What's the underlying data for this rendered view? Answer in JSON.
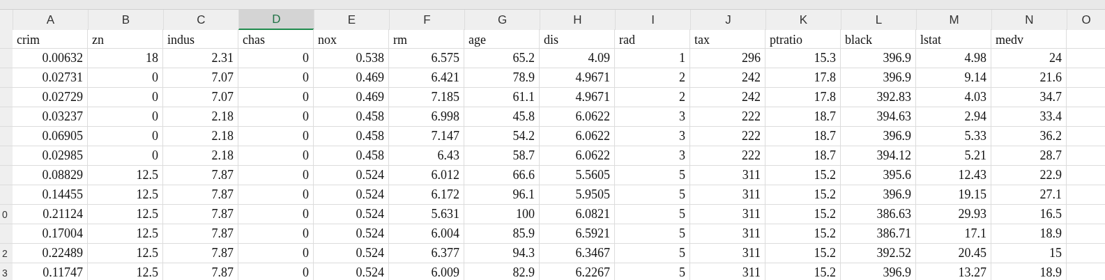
{
  "columns": [
    {
      "letter": "A",
      "selected": false
    },
    {
      "letter": "B",
      "selected": false
    },
    {
      "letter": "C",
      "selected": false
    },
    {
      "letter": "D",
      "selected": true
    },
    {
      "letter": "E",
      "selected": false
    },
    {
      "letter": "F",
      "selected": false
    },
    {
      "letter": "G",
      "selected": false
    },
    {
      "letter": "H",
      "selected": false
    },
    {
      "letter": "I",
      "selected": false
    },
    {
      "letter": "J",
      "selected": false
    },
    {
      "letter": "K",
      "selected": false
    },
    {
      "letter": "L",
      "selected": false
    },
    {
      "letter": "M",
      "selected": false
    },
    {
      "letter": "N",
      "selected": false
    },
    {
      "letter": "O",
      "selected": false
    }
  ],
  "header_row": {
    "cells": [
      "crim",
      "zn",
      "indus",
      "chas",
      "nox",
      "rm",
      "age",
      "dis",
      "rad",
      "tax",
      "ptratio",
      "black",
      "lstat",
      "medv"
    ]
  },
  "rows": [
    {
      "cells": [
        "0.00632",
        "18",
        "2.31",
        "0",
        "0.538",
        "6.575",
        "65.2",
        "4.09",
        "1",
        "296",
        "15.3",
        "396.9",
        "4.98",
        "24"
      ]
    },
    {
      "cells": [
        "0.02731",
        "0",
        "7.07",
        "0",
        "0.469",
        "6.421",
        "78.9",
        "4.9671",
        "2",
        "242",
        "17.8",
        "396.9",
        "9.14",
        "21.6"
      ]
    },
    {
      "cells": [
        "0.02729",
        "0",
        "7.07",
        "0",
        "0.469",
        "7.185",
        "61.1",
        "4.9671",
        "2",
        "242",
        "17.8",
        "392.83",
        "4.03",
        "34.7"
      ]
    },
    {
      "cells": [
        "0.03237",
        "0",
        "2.18",
        "0",
        "0.458",
        "6.998",
        "45.8",
        "6.0622",
        "3",
        "222",
        "18.7",
        "394.63",
        "2.94",
        "33.4"
      ]
    },
    {
      "cells": [
        "0.06905",
        "0",
        "2.18",
        "0",
        "0.458",
        "7.147",
        "54.2",
        "6.0622",
        "3",
        "222",
        "18.7",
        "396.9",
        "5.33",
        "36.2"
      ]
    },
    {
      "cells": [
        "0.02985",
        "0",
        "2.18",
        "0",
        "0.458",
        "6.43",
        "58.7",
        "6.0622",
        "3",
        "222",
        "18.7",
        "394.12",
        "5.21",
        "28.7"
      ]
    },
    {
      "cells": [
        "0.08829",
        "12.5",
        "7.87",
        "0",
        "0.524",
        "6.012",
        "66.6",
        "5.5605",
        "5",
        "311",
        "15.2",
        "395.6",
        "12.43",
        "22.9"
      ]
    },
    {
      "cells": [
        "0.14455",
        "12.5",
        "7.87",
        "0",
        "0.524",
        "6.172",
        "96.1",
        "5.9505",
        "5",
        "311",
        "15.2",
        "396.9",
        "19.15",
        "27.1"
      ]
    },
    {
      "row_number": "0",
      "cells": [
        "0.21124",
        "12.5",
        "7.87",
        "0",
        "0.524",
        "5.631",
        "100",
        "6.0821",
        "5",
        "311",
        "15.2",
        "386.63",
        "29.93",
        "16.5"
      ]
    },
    {
      "cells": [
        "0.17004",
        "12.5",
        "7.87",
        "0",
        "0.524",
        "6.004",
        "85.9",
        "6.5921",
        "5",
        "311",
        "15.2",
        "386.71",
        "17.1",
        "18.9"
      ]
    },
    {
      "row_number": "2",
      "cells": [
        "0.22489",
        "12.5",
        "7.87",
        "0",
        "0.524",
        "6.377",
        "94.3",
        "6.3467",
        "5",
        "311",
        "15.2",
        "392.52",
        "20.45",
        "15"
      ]
    },
    {
      "row_number": "3",
      "cells": [
        "0.11747",
        "12.5",
        "7.87",
        "0",
        "0.524",
        "6.009",
        "82.9",
        "6.2267",
        "5",
        "311",
        "15.2",
        "396.9",
        "13.27",
        "18.9"
      ]
    }
  ]
}
